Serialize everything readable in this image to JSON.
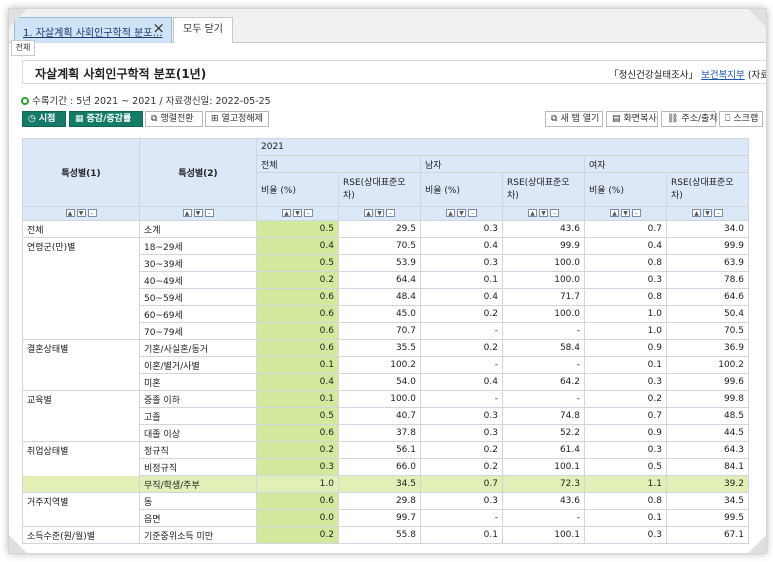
{
  "tabs": {
    "active_label": "1. 자살계획 사회인구학적 분포…",
    "close_icon": "×",
    "close_all": "모두 닫기",
    "sub_all": "전체"
  },
  "title": "자살계획 사회인구학적 분포(1년)",
  "source": {
    "prefix": "「정신건강실태조사」",
    "org": "보건복지부",
    "suffix": "(자료"
  },
  "period": "수록기간 : 5년 2021 ~ 2021 / 자료갱신일: 2022-05-25",
  "toolbar": {
    "view": "시점",
    "change": "증감/증감률",
    "pivot": "행렬전환",
    "unfix": "열고정해제",
    "newtab": "새 탭 열기",
    "capture": "화면복사",
    "url": "주소/출처",
    "scrap": "스크랩"
  },
  "table": {
    "h1": "특성별(1)",
    "h2": "특성별(2)",
    "year": "2021",
    "groups": [
      "전체",
      "남자",
      "여자"
    ],
    "sub_rate": "비율 (%)",
    "sub_rse": "RSE(상대표준오차)",
    "rows": [
      {
        "g1": "전체",
        "g2": "소계",
        "v": [
          "0.5",
          "29.5",
          "0.3",
          "43.6",
          "0.7",
          "34.0"
        ]
      },
      {
        "g1": "연령군(만)별",
        "g2": "18~29세",
        "v": [
          "0.4",
          "70.5",
          "0.4",
          "99.9",
          "0.4",
          "99.9"
        ]
      },
      {
        "g1": "",
        "g2": "30~39세",
        "v": [
          "0.5",
          "53.9",
          "0.3",
          "100.0",
          "0.8",
          "63.9"
        ]
      },
      {
        "g1": "",
        "g2": "40~49세",
        "v": [
          "0.2",
          "64.4",
          "0.1",
          "100.0",
          "0.3",
          "78.6"
        ]
      },
      {
        "g1": "",
        "g2": "50~59세",
        "v": [
          "0.6",
          "48.4",
          "0.4",
          "71.7",
          "0.8",
          "64.6"
        ]
      },
      {
        "g1": "",
        "g2": "60~69세",
        "v": [
          "0.6",
          "45.0",
          "0.2",
          "100.0",
          "1.0",
          "50.4"
        ]
      },
      {
        "g1": "",
        "g2": "70~79세",
        "v": [
          "0.6",
          "70.7",
          "-",
          "-",
          "1.0",
          "70.5"
        ]
      },
      {
        "g1": "결혼상태별",
        "g2": "기혼/사실혼/동거",
        "v": [
          "0.6",
          "35.5",
          "0.2",
          "58.4",
          "0.9",
          "36.9"
        ]
      },
      {
        "g1": "",
        "g2": "이혼/별거/사별",
        "v": [
          "0.1",
          "100.2",
          "-",
          "-",
          "0.1",
          "100.2"
        ]
      },
      {
        "g1": "",
        "g2": "미혼",
        "v": [
          "0.4",
          "54.0",
          "0.4",
          "64.2",
          "0.3",
          "99.6"
        ]
      },
      {
        "g1": "교육별",
        "g2": "중졸 이하",
        "v": [
          "0.1",
          "100.0",
          "-",
          "-",
          "0.2",
          "99.8"
        ]
      },
      {
        "g1": "",
        "g2": "고졸",
        "v": [
          "0.5",
          "40.7",
          "0.3",
          "74.8",
          "0.7",
          "48.5"
        ]
      },
      {
        "g1": "",
        "g2": "대졸 이상",
        "v": [
          "0.6",
          "37.8",
          "0.3",
          "52.2",
          "0.9",
          "44.5"
        ]
      },
      {
        "g1": "취업상태별",
        "g2": "정규직",
        "v": [
          "0.2",
          "56.1",
          "0.2",
          "61.4",
          "0.3",
          "64.3"
        ]
      },
      {
        "g1": "",
        "g2": "비정규직",
        "v": [
          "0.3",
          "66.0",
          "0.2",
          "100.1",
          "0.5",
          "84.1"
        ]
      },
      {
        "g1": "",
        "g2": "무직/학생/주부",
        "v": [
          "1.0",
          "34.5",
          "0.7",
          "72.3",
          "1.1",
          "39.2"
        ],
        "highlight": true
      },
      {
        "g1": "거주지역별",
        "g2": "동",
        "v": [
          "0.6",
          "29.8",
          "0.3",
          "43.6",
          "0.8",
          "34.5"
        ]
      },
      {
        "g1": "",
        "g2": "읍면",
        "v": [
          "0.0",
          "99.7",
          "-",
          "-",
          "0.1",
          "99.5"
        ]
      },
      {
        "g1": "소득수준(원/월)별",
        "g2": "기준중위소득 미만",
        "v": [
          "0.2",
          "55.8",
          "0.1",
          "100.1",
          "0.3",
          "67.1"
        ]
      }
    ]
  },
  "colors": {
    "accent_green": "#157b67",
    "header_blue": "#dce8f8",
    "column_green": "#d3ea9e",
    "row_highlight": "#e2f0b8"
  }
}
